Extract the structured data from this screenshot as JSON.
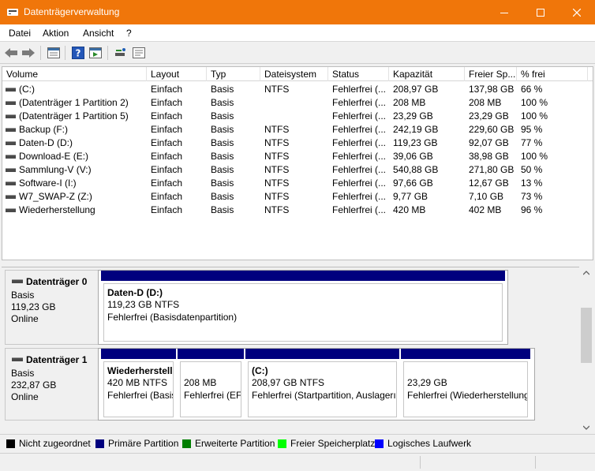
{
  "window": {
    "title": "Datenträgerverwaltung",
    "accent": "#f0760a"
  },
  "menu": [
    {
      "label": "Datei"
    },
    {
      "label": "Aktion"
    },
    {
      "label": "Ansicht"
    },
    {
      "label": "?"
    }
  ],
  "toolbar": {
    "buttons": [
      "back-arrow-icon",
      "forward-arrow-icon",
      "disk-list-icon",
      "help-icon",
      "properties-icon",
      "disk-rescan-icon",
      "console-icon"
    ]
  },
  "volume_table": {
    "columns": [
      "Volume",
      "Layout",
      "Typ",
      "Dateisystem",
      "Status",
      "Kapazität",
      "Freier Sp...",
      "% frei"
    ],
    "rows": [
      {
        "volume": " (C:)",
        "layout": "Einfach",
        "typ": "Basis",
        "fs": "NTFS",
        "status": "Fehlerfrei (...",
        "capacity": "208,97 GB",
        "free": "137,98 GB",
        "pct": "66 %"
      },
      {
        "volume": "(Datenträger 1 Partition 2)",
        "layout": "Einfach",
        "typ": "Basis",
        "fs": "",
        "status": "Fehlerfrei (...",
        "capacity": "208 MB",
        "free": "208 MB",
        "pct": "100 %"
      },
      {
        "volume": "(Datenträger 1 Partition 5)",
        "layout": "Einfach",
        "typ": "Basis",
        "fs": "",
        "status": "Fehlerfrei (...",
        "capacity": "23,29 GB",
        "free": "23,29 GB",
        "pct": "100 %"
      },
      {
        "volume": "Backup (F:)",
        "layout": "Einfach",
        "typ": "Basis",
        "fs": "NTFS",
        "status": "Fehlerfrei (...",
        "capacity": "242,19 GB",
        "free": "229,60 GB",
        "pct": "95 %"
      },
      {
        "volume": "Daten-D (D:)",
        "layout": "Einfach",
        "typ": "Basis",
        "fs": "NTFS",
        "status": "Fehlerfrei (...",
        "capacity": "119,23 GB",
        "free": "92,07 GB",
        "pct": "77 %"
      },
      {
        "volume": "Download-E (E:)",
        "layout": "Einfach",
        "typ": "Basis",
        "fs": "NTFS",
        "status": "Fehlerfrei (...",
        "capacity": "39,06 GB",
        "free": "38,98 GB",
        "pct": "100 %"
      },
      {
        "volume": "Sammlung-V (V:)",
        "layout": "Einfach",
        "typ": "Basis",
        "fs": "NTFS",
        "status": "Fehlerfrei (...",
        "capacity": "540,88 GB",
        "free": "271,80 GB",
        "pct": "50 %"
      },
      {
        "volume": "Software-I (I:)",
        "layout": "Einfach",
        "typ": "Basis",
        "fs": "NTFS",
        "status": "Fehlerfrei (...",
        "capacity": "97,66 GB",
        "free": "12,67 GB",
        "pct": "13 %"
      },
      {
        "volume": "W7_SWAP-Z (Z:)",
        "layout": "Einfach",
        "typ": "Basis",
        "fs": "NTFS",
        "status": "Fehlerfrei (...",
        "capacity": "9,77 GB",
        "free": "7,10 GB",
        "pct": "73 %"
      },
      {
        "volume": "Wiederherstellung",
        "layout": "Einfach",
        "typ": "Basis",
        "fs": "NTFS",
        "status": "Fehlerfrei (...",
        "capacity": "420 MB",
        "free": "402 MB",
        "pct": "96 %"
      }
    ]
  },
  "disks": [
    {
      "name": "Datenträger 0",
      "type": "Basis",
      "size": "119,23 GB",
      "state": "Online",
      "partitions": [
        {
          "title": "Daten-D  (D:)",
          "size": "119,23 GB NTFS",
          "status": "Fehlerfrei (Basisdatenpartition)"
        }
      ]
    },
    {
      "name": "Datenträger 1",
      "type": "Basis",
      "size": "232,87 GB",
      "state": "Online",
      "partitions": [
        {
          "title": "Wiederherstell",
          "size": "420 MB NTFS",
          "status": "Fehlerfrei (Basis"
        },
        {
          "title": "",
          "size": "208 MB",
          "status": "Fehlerfrei (EFI"
        },
        {
          "title": " (C:)",
          "size": "208,97 GB NTFS",
          "status": "Fehlerfrei (Startpartition, Auslagerı"
        },
        {
          "title": "",
          "size": "23,29 GB",
          "status": "Fehlerfrei (Wiederherstellung"
        }
      ]
    }
  ],
  "legend": [
    {
      "label": "Nicht zugeordnet",
      "color": "#000000"
    },
    {
      "label": "Primäre Partition",
      "color": "#00007e"
    },
    {
      "label": "Erweiterte Partition",
      "color": "#007e00"
    },
    {
      "label": "Freier Speicherplatz",
      "color": "#00ff00"
    },
    {
      "label": "Logisches Laufwerk",
      "color": "#0000ff"
    }
  ]
}
